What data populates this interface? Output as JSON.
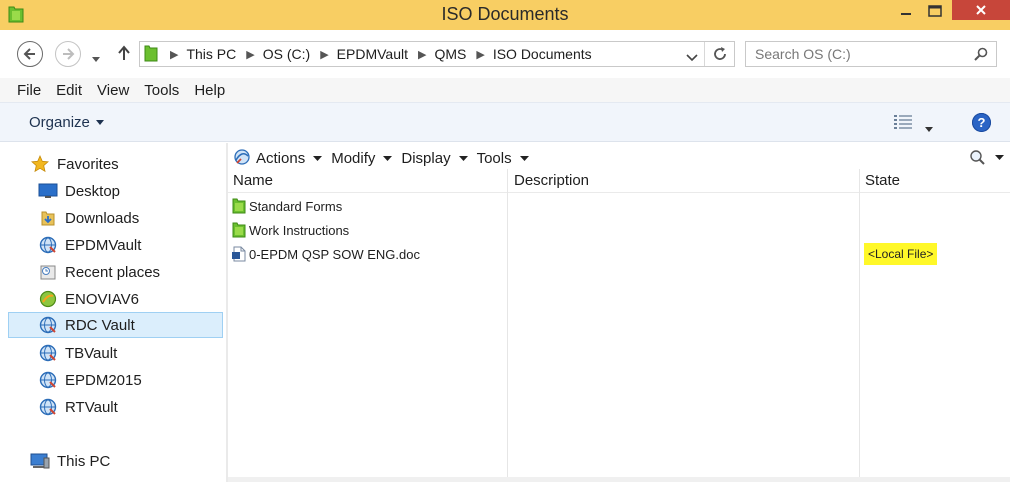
{
  "window": {
    "title": "ISO Documents"
  },
  "address": {
    "crumbs": [
      "This PC",
      "OS (C:)",
      "EPDMVault",
      "QMS",
      "ISO Documents"
    ]
  },
  "search": {
    "placeholder": "Search OS (C:)"
  },
  "menubar": {
    "items": [
      "File",
      "Edit",
      "View",
      "Tools",
      "Help"
    ]
  },
  "commandbar": {
    "organize_label": "Organize",
    "help_label": "?"
  },
  "navpane": {
    "items": [
      {
        "label": "Favorites",
        "icon": "star-icon"
      },
      {
        "label": "Desktop",
        "icon": "desktop-icon"
      },
      {
        "label": "Downloads",
        "icon": "downloads-folder-icon"
      },
      {
        "label": "EPDMVault",
        "icon": "vault-icon"
      },
      {
        "label": "Recent places",
        "icon": "recent-places-icon"
      },
      {
        "label": "ENOVIAV6",
        "icon": "enovia-icon"
      },
      {
        "label": "RDC Vault",
        "icon": "vault-icon"
      },
      {
        "label": "TBVault",
        "icon": "vault-icon"
      },
      {
        "label": "EPDM2015",
        "icon": "vault-icon"
      },
      {
        "label": "RTVault",
        "icon": "vault-icon"
      },
      {
        "label": "This PC",
        "icon": "computer-icon"
      }
    ],
    "selected": "RDC Vault"
  },
  "pdm_toolbar": {
    "items": [
      "Actions",
      "Modify",
      "Display",
      "Tools"
    ]
  },
  "columns": {
    "name": "Name",
    "description": "Description",
    "state": "State"
  },
  "files": [
    {
      "name": "Standard Forms",
      "icon": "folder-icon",
      "description": "",
      "state": ""
    },
    {
      "name": "Work Instructions",
      "icon": "folder-icon",
      "description": "",
      "state": ""
    },
    {
      "name": "0-EPDM QSP SOW ENG.doc",
      "icon": "word-doc-icon",
      "description": "",
      "state": "<Local File>"
    }
  ],
  "colors": {
    "titlebar": "#f8ce63",
    "close_button": "#c7463a",
    "state_highlight": "#fff829",
    "selection": "#dbeefc"
  }
}
